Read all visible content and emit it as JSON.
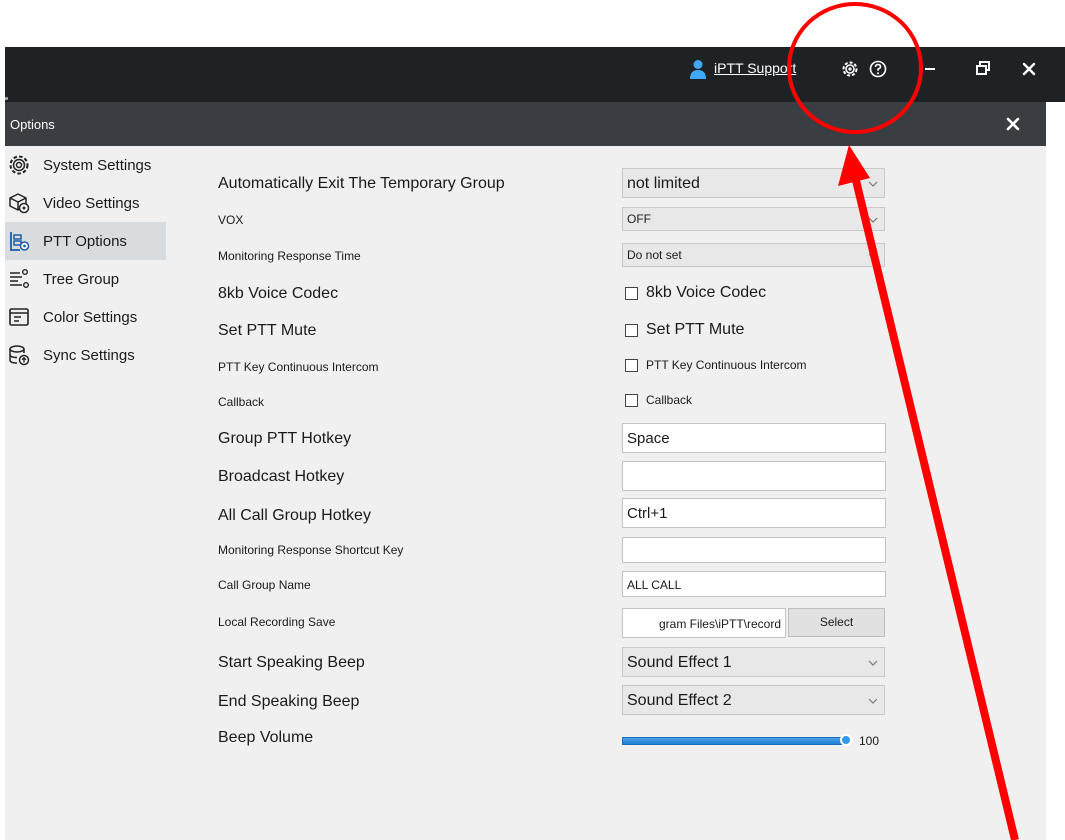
{
  "topbar": {
    "support_label": "iPTT Support",
    "icons": [
      "user-icon",
      "gear-icon",
      "help-icon",
      "minimize-icon",
      "restore-icon",
      "close-icon"
    ]
  },
  "dialog": {
    "title": "Options"
  },
  "sidebar": {
    "items": [
      {
        "label": "System Settings",
        "icon": "gear-icon"
      },
      {
        "label": "Video Settings",
        "icon": "video-settings-icon"
      },
      {
        "label": "PTT Options",
        "icon": "ptt-options-icon",
        "active": true
      },
      {
        "label": "Tree Group",
        "icon": "tree-group-icon"
      },
      {
        "label": "Color Settings",
        "icon": "color-settings-icon"
      },
      {
        "label": "Sync Settings",
        "icon": "sync-settings-icon"
      }
    ]
  },
  "settings": {
    "exit_temp_group": {
      "label": "Automatically Exit The Temporary Group",
      "value": "not limited"
    },
    "vox": {
      "label": "VOX",
      "value": "OFF"
    },
    "monitoring_response_time": {
      "label": "Monitoring Response Time",
      "value": "Do not set"
    },
    "voice_codec": {
      "label": "8kb Voice Codec",
      "checkbox_label": "8kb Voice Codec",
      "checked": false
    },
    "ptt_mute": {
      "label": "Set PTT Mute",
      "checkbox_label": "Set PTT Mute",
      "checked": false
    },
    "ptt_continuous": {
      "label": "PTT Key Continuous Intercom",
      "checkbox_label": "PTT Key Continuous Intercom",
      "checked": false
    },
    "callback": {
      "label": "Callback",
      "checkbox_label": "Callback",
      "checked": false
    },
    "group_ptt_hotkey": {
      "label": "Group PTT Hotkey",
      "value": "Space"
    },
    "broadcast_hotkey": {
      "label": "Broadcast Hotkey",
      "value": ""
    },
    "all_call_hotkey": {
      "label": "All Call Group Hotkey",
      "value": "Ctrl+1"
    },
    "monitoring_shortcut": {
      "label": "Monitoring Response Shortcut Key",
      "value": ""
    },
    "call_group_name": {
      "label": "Call Group Name",
      "value": "ALL CALL"
    },
    "local_recording": {
      "label": "Local Recording Save",
      "value": "gram Files\\iPTT\\record",
      "button_label": "Select"
    },
    "start_beep": {
      "label": "Start Speaking Beep",
      "value": "Sound Effect 1"
    },
    "end_beep": {
      "label": "End Speaking Beep",
      "value": "Sound Effect 2"
    },
    "beep_volume": {
      "label": "Beep Volume",
      "value": "100",
      "level": 100
    }
  },
  "annotation": {
    "color": "#ff0000"
  }
}
